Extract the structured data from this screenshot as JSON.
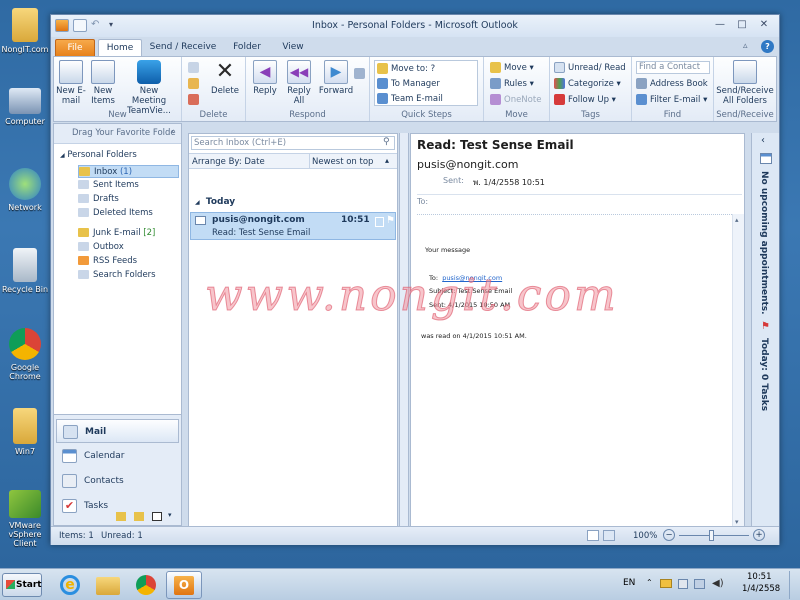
{
  "desktop": {
    "icons": [
      {
        "label": "NongIT.com"
      },
      {
        "label": "Computer"
      },
      {
        "label": "Network"
      },
      {
        "label": "Recycle Bin"
      },
      {
        "label": "Google Chrome"
      },
      {
        "label": "Win7"
      },
      {
        "label": "VMware vSphere Client"
      }
    ]
  },
  "window": {
    "title": "Inbox - Personal Folders  -  Microsoft Outlook",
    "tabs": [
      "File",
      "Home",
      "Send / Receive",
      "Folder",
      "View"
    ]
  },
  "ribbon": {
    "new": {
      "label": "New",
      "new_email": "New E-mail",
      "new_items": "New Items",
      "new_meeting": "New Meeting",
      "teamviewer": "TeamVie..."
    },
    "delete": {
      "label": "Delete",
      "delete_btn": "Delete"
    },
    "respond": {
      "label": "Respond",
      "reply": "Reply",
      "reply_all": "Reply All",
      "forward": "Forward"
    },
    "quicksteps": {
      "label": "Quick Steps",
      "items": [
        "Move to: ?",
        "To Manager",
        "Team E-mail"
      ]
    },
    "move": {
      "label": "Move",
      "move_btn": "Move",
      "rules": "Rules",
      "onenote": "OneNote"
    },
    "tags": {
      "label": "Tags",
      "unread_read": "Unread/ Read",
      "categorize": "Categorize",
      "follow_up": "Follow Up"
    },
    "find": {
      "label": "Find",
      "find_contact_placeholder": "Find a Contact",
      "address_book": "Address Book",
      "filter_email": "Filter E-mail"
    },
    "sendreceive": {
      "label": "Send/Receive",
      "btn": "Send/Receive All Folders"
    }
  },
  "navpane": {
    "favorites_header": "Drag Your Favorite Folde",
    "personal_folders": "Personal Folders",
    "folders": [
      {
        "name": "Inbox",
        "count": "(1)"
      },
      {
        "name": "Sent Items",
        "count": ""
      },
      {
        "name": "Drafts",
        "count": ""
      },
      {
        "name": "Deleted Items",
        "count": ""
      },
      {
        "name": "Junk E-mail",
        "count": "[2]"
      },
      {
        "name": "Outbox",
        "count": ""
      },
      {
        "name": "RSS Feeds",
        "count": ""
      },
      {
        "name": "Search Folders",
        "count": ""
      }
    ],
    "buttons": [
      "Mail",
      "Calendar",
      "Contacts",
      "Tasks"
    ]
  },
  "listpane": {
    "search_placeholder": "Search Inbox (Ctrl+E)",
    "arrange_by": "Arrange By: Date",
    "sort": "Newest on top",
    "group": "Today",
    "messages": [
      {
        "from": "pusis@nongit.com",
        "time": "10:51",
        "subject": "Read: Test Sense Email"
      }
    ]
  },
  "readpane": {
    "subject": "Read: Test Sense Email",
    "from": "pusis@nongit.com",
    "sent_label": "Sent:",
    "sent_value": "พ. 1/4/2558 10:51",
    "to_label": "To:",
    "body_intro": "Your message",
    "body_to_label": "To:",
    "body_to_value": "pusis@nongit.com",
    "body_subject": "Subject: Test Sense Email",
    "body_sent": "Sent: 4/1/2015 10:50 AM",
    "body_read": "was read on 4/1/2015 10:51 AM."
  },
  "todobar": {
    "appointments": "No upcoming appointments.",
    "tasks": "Today: 0 Tasks"
  },
  "statusbar": {
    "items": "Items: 1",
    "unread": "Unread: 1",
    "zoom": "100%"
  },
  "taskbar": {
    "start": "Start",
    "lang": "EN",
    "time": "10:51",
    "date": "1/4/2558"
  },
  "watermark": "www.nongit.com",
  "colors": {
    "accent": "#1e395b",
    "selection": "#c2dcf5",
    "file_tab": "#e57e17"
  }
}
